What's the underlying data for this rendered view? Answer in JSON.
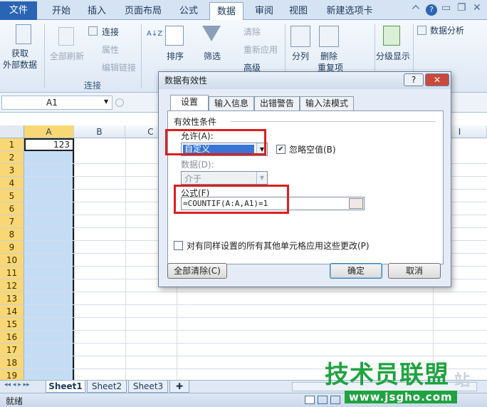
{
  "ribbon_tabs": {
    "file": "文件",
    "home": "开始",
    "insert": "插入",
    "page_layout": "页面布局",
    "formulas": "公式",
    "data": "数据",
    "review": "审阅",
    "view": "视图",
    "new_tab": "新建选项卡"
  },
  "ribbon": {
    "get_external": [
      "获取",
      "外部数据"
    ],
    "refresh_all": "全部刷新",
    "connections": "连接",
    "properties": "属性",
    "edit_links": "编辑链接",
    "group_connections": "连接",
    "sort_az": "A↓Z",
    "sort": "排序",
    "filter": "筛选",
    "clear": "清除",
    "reapply": "重新应用",
    "advanced": "高级",
    "text_to_columns": "分列",
    "remove_duplicates": "删除",
    "duplicates_sub": "重复项",
    "outline": "分级显示",
    "data_analysis": "数据分析"
  },
  "formula_bar": {
    "name_box": "A1"
  },
  "sheet": {
    "columns": [
      "A",
      "B",
      "C",
      "I"
    ],
    "rows": [
      "1",
      "2",
      "3",
      "4",
      "5",
      "6",
      "7",
      "8",
      "9",
      "10",
      "11",
      "12",
      "13",
      "14",
      "15",
      "16",
      "17",
      "18",
      "19"
    ],
    "a1_value": "123"
  },
  "sheet_tabs": [
    "Sheet1",
    "Sheet2",
    "Sheet3"
  ],
  "status": {
    "ready": "就绪"
  },
  "dialog": {
    "title": "数据有效性",
    "help": "?",
    "close": "✕",
    "tabs": [
      "设置",
      "输入信息",
      "出错警告",
      "输入法模式"
    ],
    "section": "有效性条件",
    "allow_label": "允许(A):",
    "allow_value": "自定义",
    "ignore_blank": "忽略空值(B)",
    "ignore_blank_checked": true,
    "data_label": "数据(D):",
    "data_value": "介于",
    "formula_label": "公式(F)",
    "formula_value": "=COUNTIF(A:A,A1)=1",
    "apply_all": "对有同样设置的所有其他单元格应用这些更改(P)",
    "clear_all": "全部清除(C)",
    "ok": "确定",
    "cancel": "取消"
  },
  "watermark": {
    "main": "技术员联盟",
    "url": "www.jsgho.com",
    "extra": "站"
  },
  "colors": {
    "file_tab": "#2a64b4",
    "selection": "#c5dcf5",
    "highlight": "#d9201f",
    "watermark": "#1fa340"
  }
}
